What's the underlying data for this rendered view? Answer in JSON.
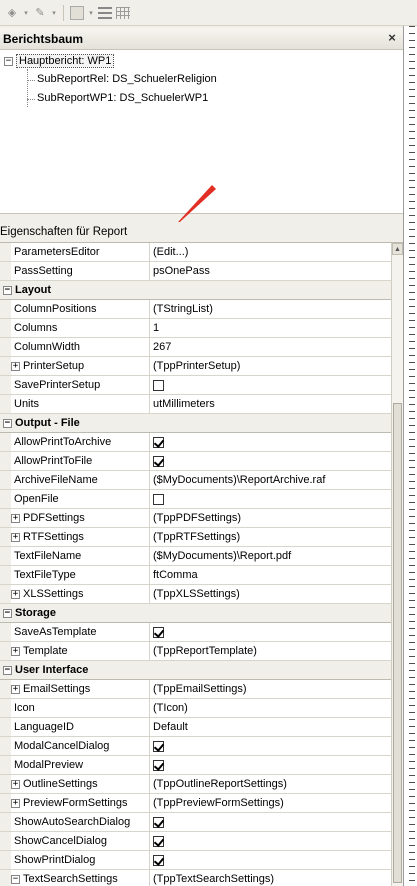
{
  "toolbar": {
    "icons": [
      "fill-color-icon",
      "line-color-icon",
      "bar-icon",
      "lines-icon",
      "grid-icon"
    ],
    "dropdown_glyph": "▾"
  },
  "report_tree": {
    "title": "Berichtsbaum",
    "close_glyph": "×",
    "root": {
      "expander": "−",
      "label": "Hauptbericht: WP1"
    },
    "children": [
      {
        "label": "SubReportRel: DS_SchuelerReligion"
      },
      {
        "label": "SubReportWP1: DS_SchuelerWP1"
      }
    ]
  },
  "properties": {
    "title": "Eigenschaften für Report",
    "rows": [
      {
        "kind": "prop",
        "name": "ParametersEditor",
        "value": "(Edit...)"
      },
      {
        "kind": "prop",
        "name": "PassSetting",
        "value": "psOnePass"
      },
      {
        "kind": "cat",
        "name": "Layout",
        "expander": "−"
      },
      {
        "kind": "prop",
        "name": "ColumnPositions",
        "value": "(TStringList)"
      },
      {
        "kind": "prop",
        "name": "Columns",
        "value": "1"
      },
      {
        "kind": "prop",
        "name": "ColumnWidth",
        "value": "267"
      },
      {
        "kind": "prop",
        "name": "PrinterSetup",
        "value": "(TppPrinterSetup)",
        "expander": "+"
      },
      {
        "kind": "prop",
        "name": "SavePrinterSetup",
        "checkbox": false
      },
      {
        "kind": "prop",
        "name": "Units",
        "value": "utMillimeters"
      },
      {
        "kind": "cat",
        "name": "Output - File",
        "expander": "−"
      },
      {
        "kind": "prop",
        "name": "AllowPrintToArchive",
        "checkbox": true
      },
      {
        "kind": "prop",
        "name": "AllowPrintToFile",
        "checkbox": true
      },
      {
        "kind": "prop",
        "name": "ArchiveFileName",
        "value": "($MyDocuments)\\ReportArchive.raf"
      },
      {
        "kind": "prop",
        "name": "OpenFile",
        "checkbox": false
      },
      {
        "kind": "prop",
        "name": "PDFSettings",
        "value": "(TppPDFSettings)",
        "expander": "+"
      },
      {
        "kind": "prop",
        "name": "RTFSettings",
        "value": "(TppRTFSettings)",
        "expander": "+"
      },
      {
        "kind": "prop",
        "name": "TextFileName",
        "value": "($MyDocuments)\\Report.pdf"
      },
      {
        "kind": "prop",
        "name": "TextFileType",
        "value": "ftComma"
      },
      {
        "kind": "prop",
        "name": "XLSSettings",
        "value": "(TppXLSSettings)",
        "expander": "+"
      },
      {
        "kind": "cat",
        "name": "Storage",
        "expander": "−"
      },
      {
        "kind": "prop",
        "name": "SaveAsTemplate",
        "checkbox": true
      },
      {
        "kind": "prop",
        "name": "Template",
        "value": "(TppReportTemplate)",
        "expander": "+"
      },
      {
        "kind": "cat",
        "name": "User Interface",
        "expander": "−"
      },
      {
        "kind": "prop",
        "name": "EmailSettings",
        "value": "(TppEmailSettings)",
        "expander": "+"
      },
      {
        "kind": "prop",
        "name": "Icon",
        "value": "(TIcon)"
      },
      {
        "kind": "prop",
        "name": "LanguageID",
        "value": "Default"
      },
      {
        "kind": "prop",
        "name": "ModalCancelDialog",
        "checkbox": true
      },
      {
        "kind": "prop",
        "name": "ModalPreview",
        "checkbox": true
      },
      {
        "kind": "prop",
        "name": "OutlineSettings",
        "value": "(TppOutlineReportSettings)",
        "expander": "+"
      },
      {
        "kind": "prop",
        "name": "PreviewFormSettings",
        "value": "(TppPreviewFormSettings)",
        "expander": "+"
      },
      {
        "kind": "prop",
        "name": "ShowAutoSearchDialog",
        "checkbox": true
      },
      {
        "kind": "prop",
        "name": "ShowCancelDialog",
        "checkbox": true
      },
      {
        "kind": "prop",
        "name": "ShowPrintDialog",
        "checkbox": true
      },
      {
        "kind": "prop",
        "name": "TextSearchSettings",
        "value": "(TppTextSearchSettings)",
        "expander": "−"
      }
    ]
  },
  "annotation": {
    "arrow_color": "#e8211a"
  }
}
